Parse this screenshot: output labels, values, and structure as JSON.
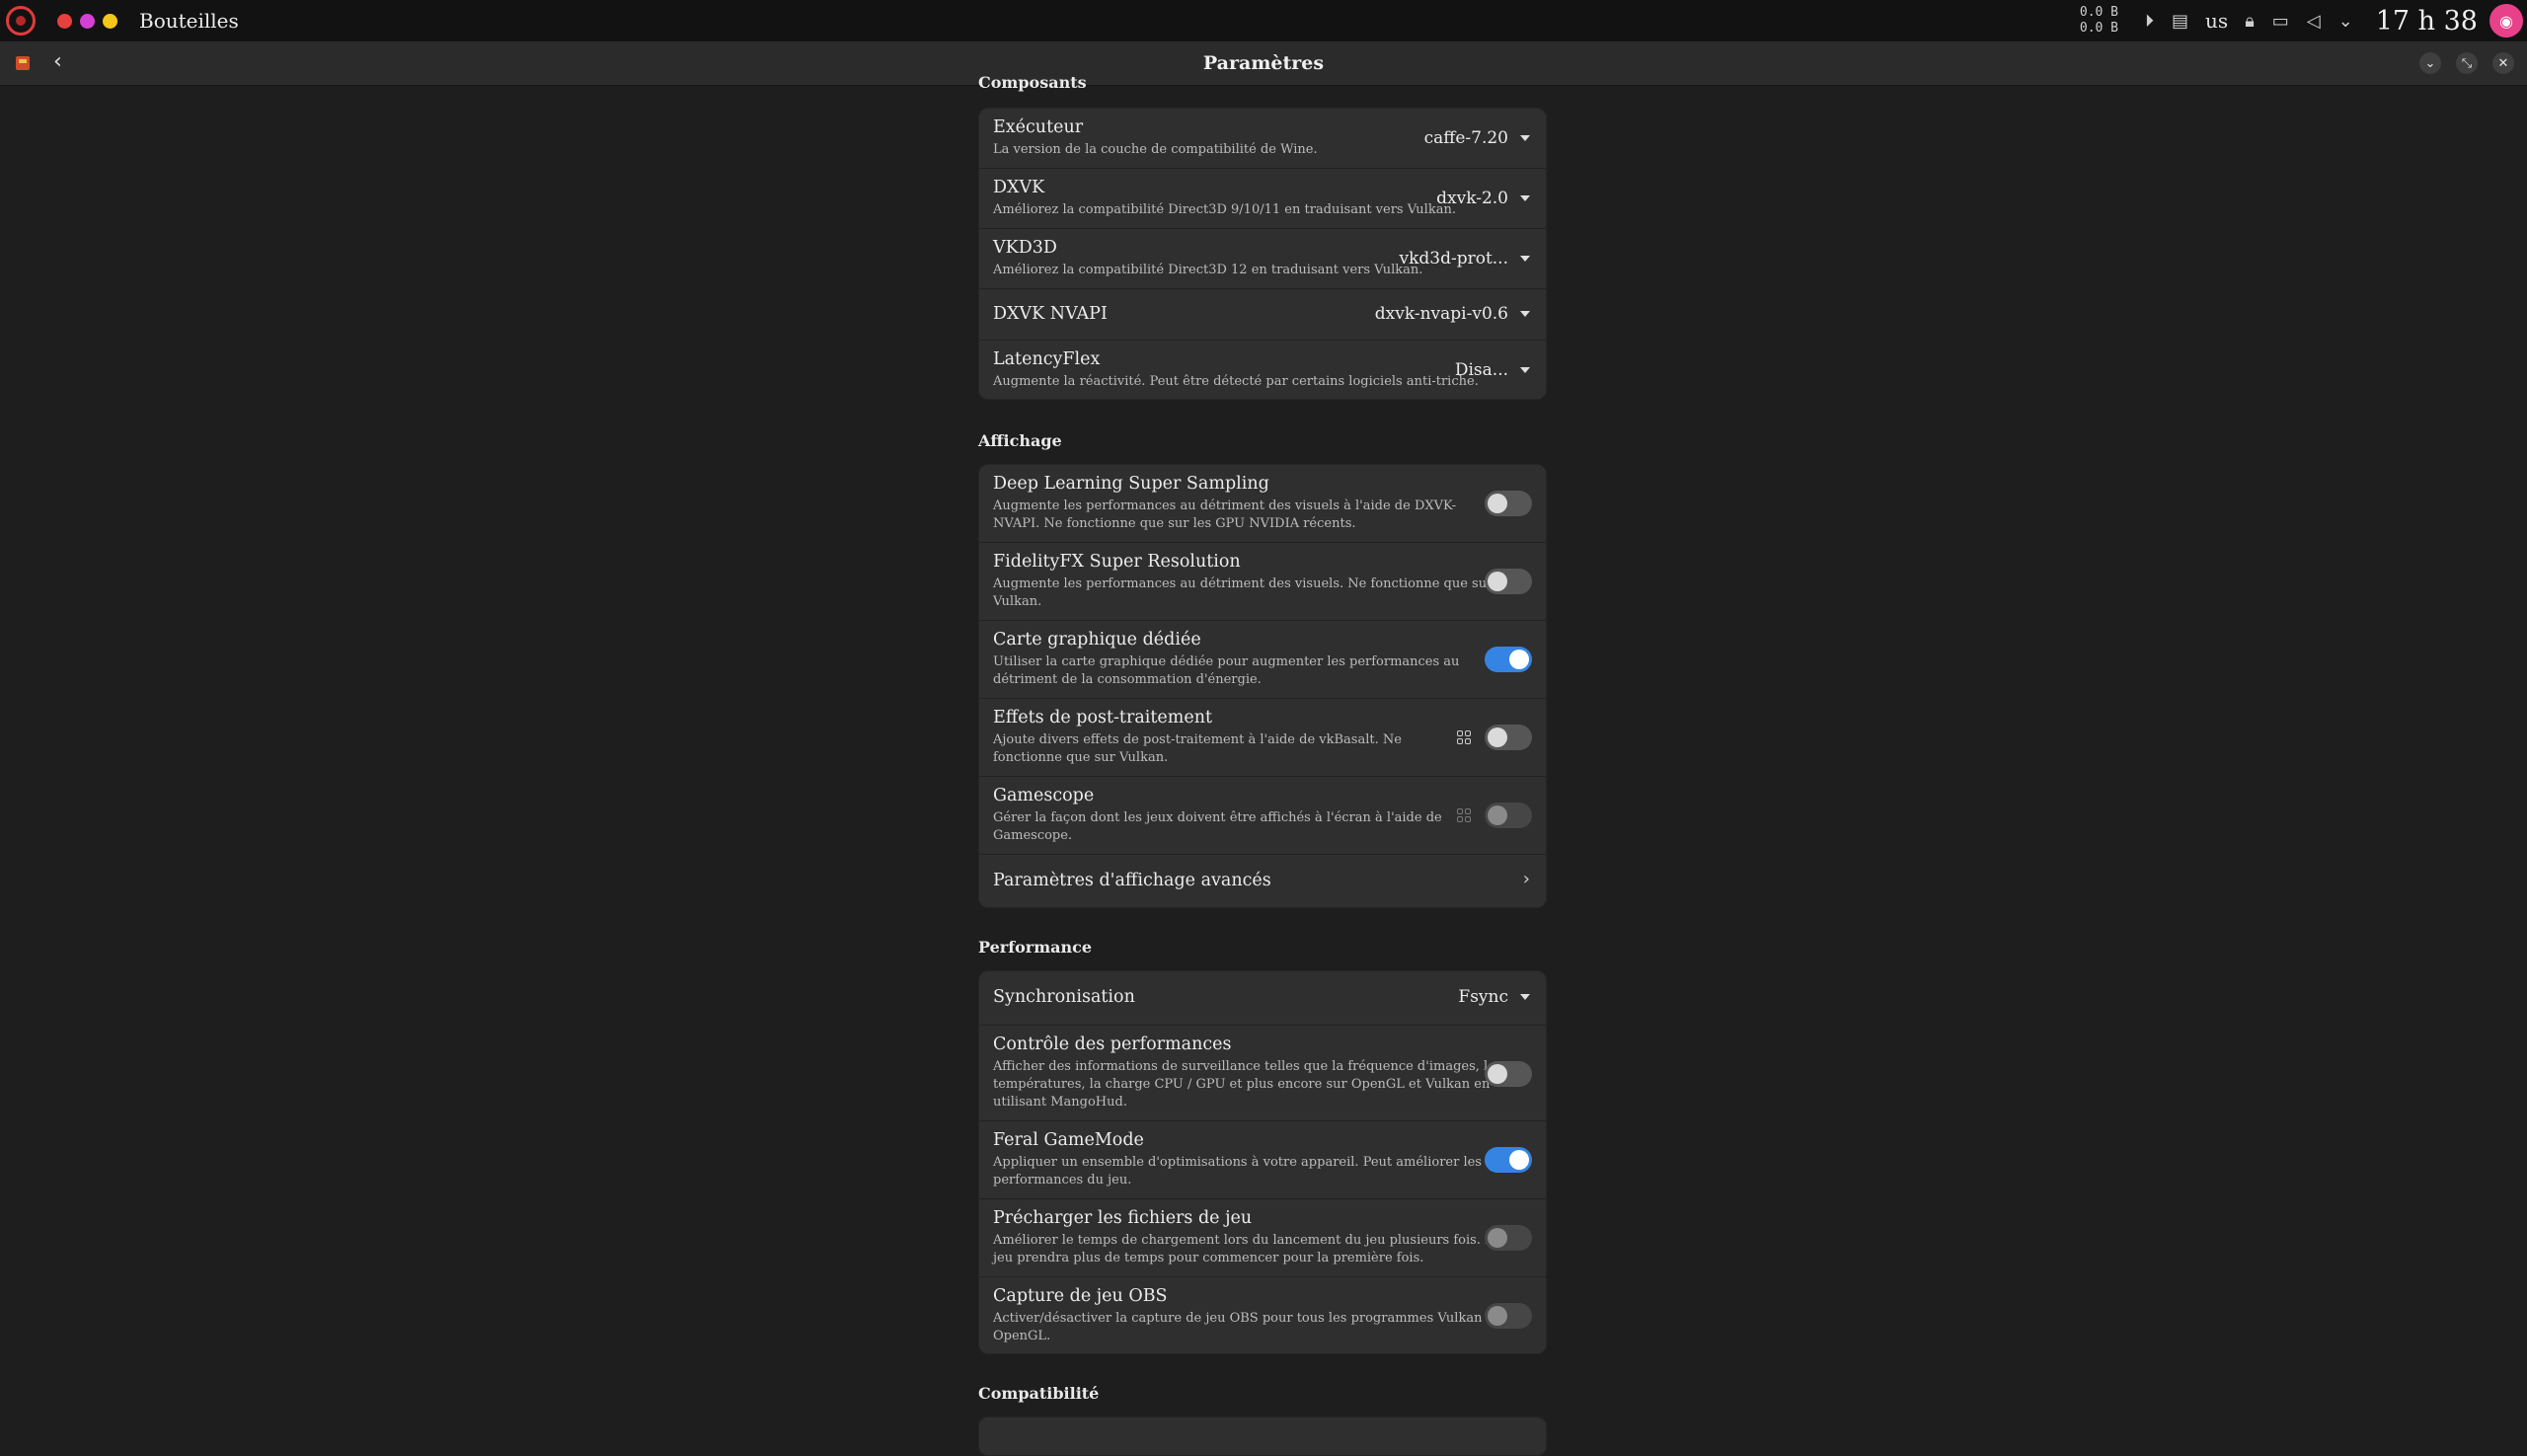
{
  "topbar": {
    "app_name": "Bouteilles",
    "dot_colors": [
      "#e83f3f",
      "#d63fd6",
      "#f5c518"
    ],
    "net_up": "0.0 B",
    "net_down": "0.0 B",
    "keyboard_layout": "us",
    "clock": "17 h 38",
    "icons": [
      "play-circle-icon",
      "clipboard-icon",
      "lock-icon",
      "display-icon",
      "volume-icon",
      "chevron-down-icon"
    ]
  },
  "header": {
    "title": "Paramètres"
  },
  "sections": {
    "components": {
      "title": "Composants",
      "rows": [
        {
          "title": "Exécuteur",
          "subtitle": "La version de la couche de compatibilité de Wine.",
          "value": "caffe-7.20"
        },
        {
          "title": "DXVK",
          "subtitle": "Améliorez la compatibilité Direct3D 9/10/11 en traduisant vers Vulkan.",
          "value": "dxvk-2.0"
        },
        {
          "title": "VKD3D",
          "subtitle": "Améliorez la compatibilité Direct3D 12 en traduisant vers Vulkan.",
          "value": "vkd3d-prot..."
        },
        {
          "title": "DXVK NVAPI",
          "subtitle": "",
          "value": "dxvk-nvapi-v0.6"
        },
        {
          "title": "LatencyFlex",
          "subtitle": "Augmente la réactivité. Peut être détecté par certains logiciels anti-triche.",
          "value": "Disa..."
        }
      ]
    },
    "display": {
      "title": "Affichage",
      "rows": [
        {
          "title": "Deep Learning Super Sampling",
          "line1": "Augmente les performances au détriment des visuels à l'aide de DXVK-",
          "line2": "NVAPI. Ne fonctionne que sur les GPU NVIDIA récents.",
          "enabled": false
        },
        {
          "title": "FidelityFX Super Resolution",
          "line1": "Augmente les performances au détriment des visuels. Ne fonctionne que sur",
          "line2": "Vulkan.",
          "enabled": false
        },
        {
          "title": "Carte graphique dédiée",
          "line1": "Utiliser la carte graphique dédiée pour augmenter les performances au",
          "line2": "détriment de la consommation d'énergie.",
          "enabled": true
        },
        {
          "title": "Effets de post-traitement",
          "line1": "Ajoute divers effets de post-traitement à l'aide de vkBasalt. Ne",
          "line2": "fonctionne que sur Vulkan.",
          "enabled": false
        },
        {
          "title": "Gamescope",
          "line1": "Gérer la façon dont les jeux doivent être affichés à l'écran à l'aide de",
          "line2": "Gamescope.",
          "enabled": false
        },
        {
          "title": "Paramètres d'affichage avancés"
        }
      ]
    },
    "performance": {
      "title": "Performance",
      "sync": {
        "title": "Synchronisation",
        "value": "Fsync"
      },
      "rows": [
        {
          "title": "Contrôle des performances",
          "line1": "Afficher des informations de surveillance telles que la fréquence d'images, les",
          "line2": "températures, la charge CPU / GPU et plus encore sur OpenGL et Vulkan en",
          "line3": "utilisant MangoHud.",
          "enabled": false
        },
        {
          "title": "Feral GameMode",
          "line1": "Appliquer un ensemble d'optimisations à votre appareil. Peut améliorer les",
          "line2": "performances du jeu.",
          "enabled": true
        },
        {
          "title": "Précharger les fichiers de jeu",
          "line1": "Améliorer le temps de chargement lors du lancement du jeu plusieurs fois. Le",
          "line2": "jeu prendra plus de temps pour commencer pour la première fois.",
          "enabled": false
        },
        {
          "title": "Capture de jeu OBS",
          "line1": "Activer/désactiver la capture de jeu OBS pour tous les programmes Vulkan et",
          "line2": "OpenGL.",
          "enabled": false
        }
      ]
    },
    "compat": {
      "title": "Compatibilité"
    }
  }
}
